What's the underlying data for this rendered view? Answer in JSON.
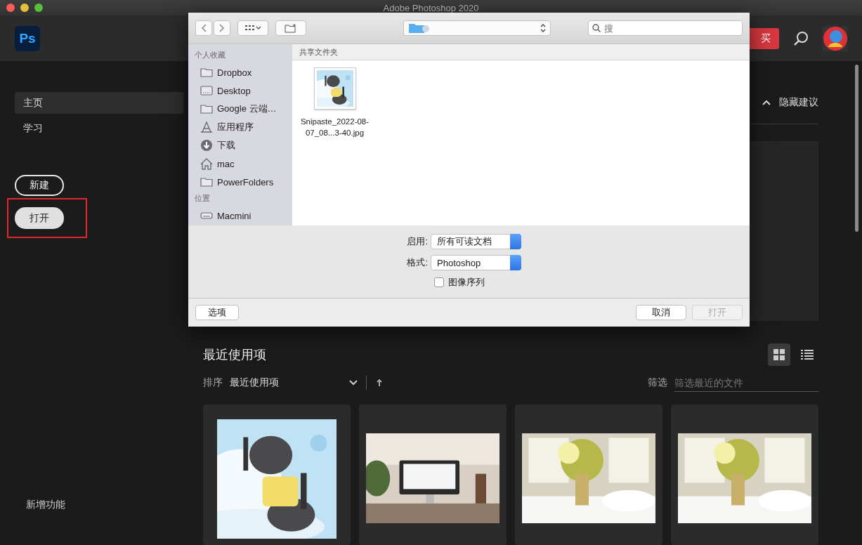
{
  "window": {
    "title": "Adobe Photoshop 2020"
  },
  "header": {
    "logo": "Ps",
    "buy_button": "买"
  },
  "sidebar": {
    "items": [
      {
        "label": "主页",
        "selected": true
      },
      {
        "label": "学习",
        "selected": false
      }
    ],
    "new_button": "新建",
    "open_button": "打开",
    "whats_new": "新增功能"
  },
  "suggestions": {
    "toggle": "隐藏建议",
    "expanded": true
  },
  "recent": {
    "title": "最近使用项",
    "sort_label": "排序",
    "sort_value": "最近使用项",
    "filter_label": "筛选",
    "filter_placeholder": "筛选最近的文件",
    "views": [
      {
        "kind": "grid",
        "selected": true
      },
      {
        "kind": "list",
        "selected": false
      }
    ]
  },
  "dialog": {
    "search_placeholder": "搜",
    "sidebar": [
      {
        "heading": "个人收藏",
        "items": [
          {
            "label": "Dropbox",
            "kind": "folder"
          },
          {
            "label": "Desktop",
            "kind": "desktop"
          },
          {
            "label": "Google 云端…",
            "kind": "folder"
          },
          {
            "label": "应用程序",
            "kind": "apps"
          },
          {
            "label": "下载",
            "kind": "download"
          },
          {
            "label": "mac",
            "kind": "home"
          },
          {
            "label": "PowerFolders",
            "kind": "folder"
          }
        ]
      },
      {
        "heading": "位置",
        "items": [
          {
            "label": "Macmini",
            "kind": "drive"
          }
        ]
      }
    ],
    "location_header": "共享文件夹",
    "files": [
      {
        "name": "Snipaste_2022-08-07_08...3-40.jpg",
        "kind": "picture"
      }
    ],
    "enable_label": "启用:",
    "enable_value": "所有可读文档",
    "format_label": "格式:",
    "format_value": "Photoshop",
    "sequence": {
      "label": "图像序列",
      "checked": false
    },
    "options_button": "选项",
    "cancel_button": "取消",
    "open_button": {
      "label": "打开",
      "disabled": true
    }
  }
}
